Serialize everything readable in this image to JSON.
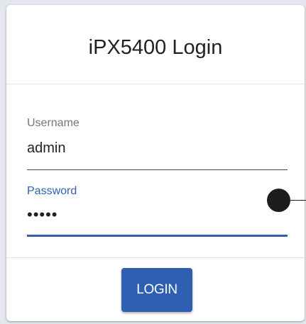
{
  "login": {
    "title": "iPX5400 Login",
    "username": {
      "label": "Username",
      "value": "admin"
    },
    "password": {
      "label": "Password",
      "value": "•••••"
    },
    "button_label": "LOGIN"
  },
  "colors": {
    "accent": "#2f5fb1",
    "background": "#e4e8ee",
    "card": "#ffffff"
  }
}
